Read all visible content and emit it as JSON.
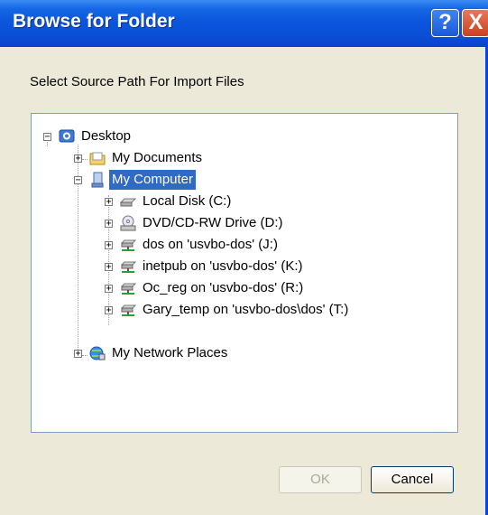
{
  "window": {
    "title": "Browse for Folder",
    "help_glyph": "?",
    "close_glyph": "X"
  },
  "prompt": "Select Source Path For Import Files",
  "tree": [
    {
      "label": "Desktop",
      "icon": "desktop-icon",
      "expander": "−"
    },
    {
      "label": "My Documents",
      "icon": "folder-icon",
      "expander": "+"
    },
    {
      "label": "My Computer",
      "icon": "computer-icon",
      "expander": "−",
      "selected": true
    },
    {
      "label": "Local Disk (C:)",
      "icon": "hard-drive-icon",
      "expander": "+"
    },
    {
      "label": "DVD/CD-RW Drive (D:)",
      "icon": "cd-drive-icon",
      "expander": "+"
    },
    {
      "label": "dos on 'usvbo-dos' (J:)",
      "icon": "network-drive-icon",
      "expander": "+"
    },
    {
      "label": "inetpub on 'usvbo-dos' (K:)",
      "icon": "network-drive-icon",
      "expander": "+"
    },
    {
      "label": "Oc_reg on 'usvbo-dos' (R:)",
      "icon": "network-drive-icon",
      "expander": "+"
    },
    {
      "label": "Gary_temp on 'usvbo-dos\\dos' (T:)",
      "icon": "network-drive-icon",
      "expander": "+"
    },
    {
      "label": "My Network Places",
      "icon": "network-places-icon",
      "expander": "+"
    }
  ],
  "buttons": {
    "ok": "OK",
    "cancel": "Cancel"
  }
}
